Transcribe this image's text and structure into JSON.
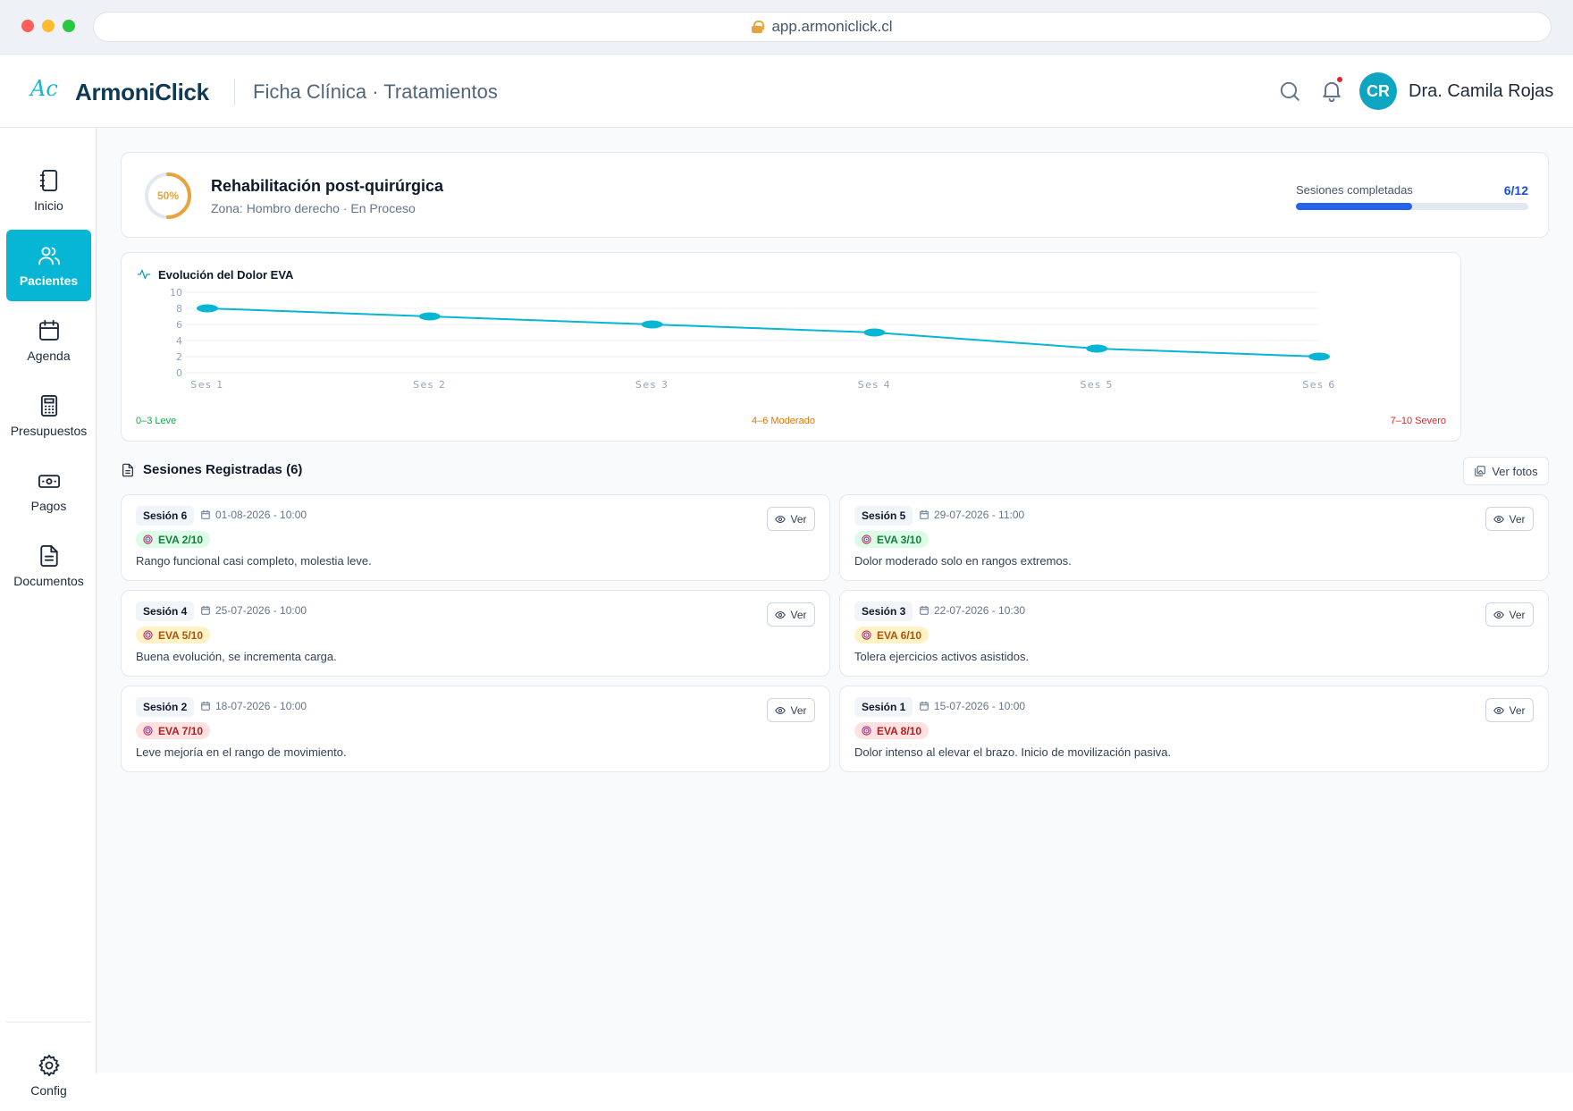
{
  "browser": {
    "url": "app.armoniclick.cl"
  },
  "header": {
    "logo_text": "Ac",
    "brand": "ArmoniClick",
    "section": "Ficha Clínica · Tratamientos",
    "user_initials": "CR",
    "user_name": "Dra. Camila Rojas"
  },
  "sidebar": {
    "items": [
      {
        "label": "Inicio",
        "icon": "notebook-icon"
      },
      {
        "label": "Pacientes",
        "icon": "users-icon",
        "active": true
      },
      {
        "label": "Agenda",
        "icon": "calendar-icon"
      },
      {
        "label": "Presupuestos",
        "icon": "calculator-icon"
      },
      {
        "label": "Pagos",
        "icon": "banknote-icon"
      },
      {
        "label": "Documentos",
        "icon": "document-icon"
      }
    ],
    "footer": {
      "label": "Config",
      "icon": "gear-icon"
    }
  },
  "treatment": {
    "progress_label": "50%",
    "progress_fraction": 0.5,
    "title": "Rehabilitación post-quirúrgica",
    "subtitle": "Zona: Hombro derecho · En Proceso",
    "sessions_label": "Sesiones completadas",
    "sessions_count": "6/12",
    "sessions_done": 6,
    "sessions_total": 12
  },
  "chart": {
    "title": "Evolución del Dolor EVA",
    "legend_low": "0–3 Leve",
    "legend_mid": "4–6 Moderado",
    "legend_high": "7–10 Severo"
  },
  "chart_data": {
    "type": "line",
    "title": "Evolución del Dolor EVA",
    "categories": [
      "Ses 1",
      "Ses 2",
      "Ses 3",
      "Ses 4",
      "Ses 5",
      "Ses 6"
    ],
    "values": [
      8,
      7,
      6,
      5,
      3,
      2
    ],
    "yticks": [
      0,
      2,
      4,
      6,
      8,
      10
    ],
    "ylim": [
      0,
      10
    ],
    "grid": true,
    "line_color": "#06b6d4"
  },
  "sessions": {
    "title": "Sesiones Registradas (6)",
    "photos_button": "Ver fotos",
    "view_label": "Ver",
    "items": [
      {
        "num": "Sesión 6",
        "date": "01-08-2026 - 10:00",
        "eva": "EVA 2/10",
        "level": "low",
        "note": "Rango funcional casi completo, molestia leve."
      },
      {
        "num": "Sesión 5",
        "date": "29-07-2026 - 11:00",
        "eva": "EVA 3/10",
        "level": "low",
        "note": "Dolor moderado solo en rangos extremos."
      },
      {
        "num": "Sesión 4",
        "date": "25-07-2026 - 10:00",
        "eva": "EVA 5/10",
        "level": "mid",
        "note": "Buena evolución, se incrementa carga."
      },
      {
        "num": "Sesión 3",
        "date": "22-07-2026 - 10:30",
        "eva": "EVA 6/10",
        "level": "mid",
        "note": "Tolera ejercicios activos asistidos."
      },
      {
        "num": "Sesión 2",
        "date": "18-07-2026 - 10:00",
        "eva": "EVA 7/10",
        "level": "high",
        "note": "Leve mejoría en el rango de movimiento."
      },
      {
        "num": "Sesión 1",
        "date": "15-07-2026 - 10:00",
        "eva": "EVA 8/10",
        "level": "high",
        "note": "Dolor intenso al elevar el brazo. Inicio de movilización pasiva."
      }
    ]
  }
}
